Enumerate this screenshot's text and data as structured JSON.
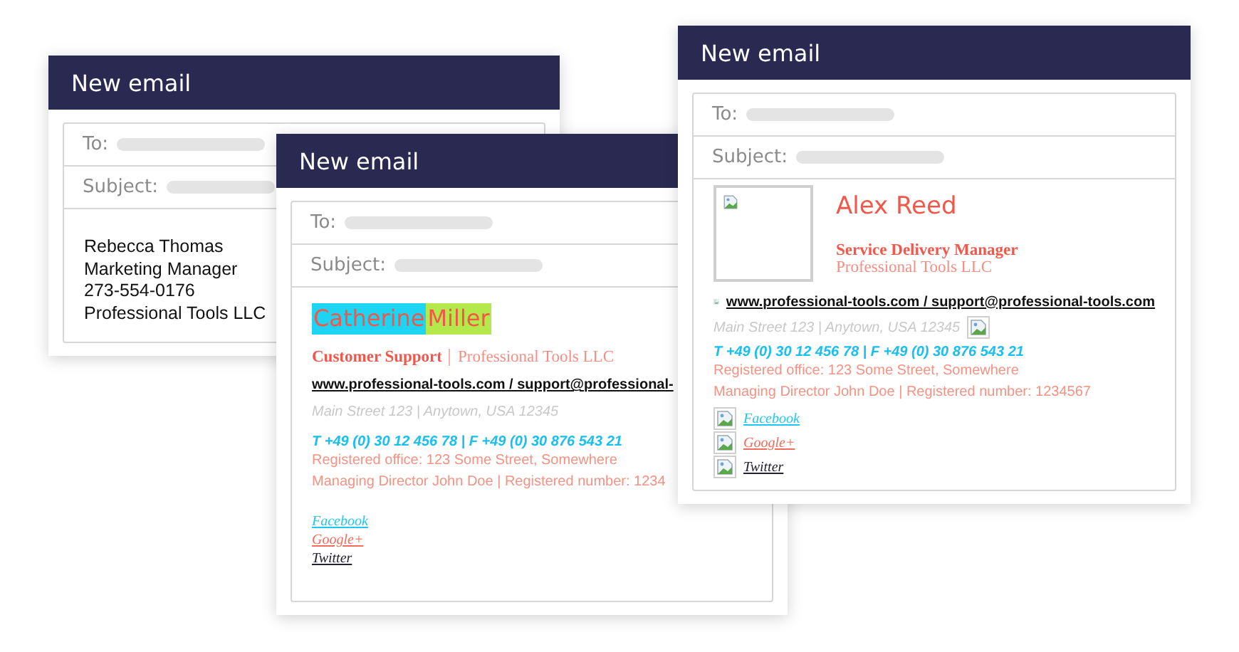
{
  "windows": [
    {
      "title": "New email",
      "fields": [
        {
          "label": "To:"
        },
        {
          "label": "Subject:"
        }
      ],
      "signature": {
        "kind": "plain",
        "lines": [
          "Rebecca Thomas",
          "Marketing Manager",
          "273-554-0176",
          "Professional Tools LLC"
        ]
      }
    },
    {
      "title": "New email",
      "fields": [
        {
          "label": "To:"
        },
        {
          "label": "Subject:"
        }
      ],
      "signature": {
        "kind": "banner",
        "name_parts": [
          {
            "text": "Catherine",
            "color": "#1fd3f2"
          },
          {
            "text": "Miller",
            "color": "#b5e84a"
          }
        ],
        "role": "Customer Support",
        "company": "Professional Tools LLC",
        "web": "www.professional-tools.com / support@professional-",
        "address": "Main Street 123 | Anytown, USA 12345",
        "phone": "T +49 (0) 30 12 456 78 | F +49 (0) 30 876 543 21",
        "office": "Registered office: 123 Some Street, Somewhere",
        "director": "Managing Director John Doe | Registered number: 1234",
        "socials": [
          {
            "label": "Facebook",
            "color": "#1fc7ef"
          },
          {
            "label": "Google+",
            "color": "#f26b5b"
          },
          {
            "label": "Twitter",
            "color": "#222233"
          }
        ]
      }
    },
    {
      "title": "New email",
      "fields": [
        {
          "label": "To:"
        },
        {
          "label": "Subject:"
        }
      ],
      "signature": {
        "kind": "photo",
        "name": "Alex Reed",
        "role": "Service Delivery Manager",
        "company": "Professional Tools LLC",
        "web": "www.professional-tools.com / support@professional-tools.com",
        "address": "Main Street 123 | Anytown, USA 12345",
        "phone": "T +49 (0) 30 12 456 78 | F +49 (0) 30 876 543 21",
        "office": "Registered office: 123 Some Street, Somewhere",
        "director": "Managing Director John Doe | Registered number: 1234567",
        "socials": [
          {
            "label": "Facebook",
            "color": "#1fc7ef"
          },
          {
            "label": "Google+",
            "color": "#f26b5b"
          },
          {
            "label": "Twitter",
            "color": "#222233"
          }
        ]
      }
    }
  ]
}
